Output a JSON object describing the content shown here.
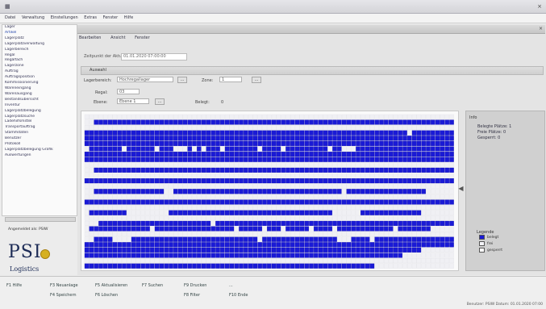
{
  "window": {
    "icon": "app-icon",
    "close_glyph": "×"
  },
  "menubar": [
    {
      "label": "Datei"
    },
    {
      "label": "Verwaltung"
    },
    {
      "label": "Einstellungen"
    },
    {
      "label": "Extras"
    },
    {
      "label": "Fenster"
    },
    {
      "label": "Hilfe"
    }
  ],
  "sidebar": {
    "items": [
      {
        "label": "Lager",
        "selected": false
      },
      {
        "label": "Artikel",
        "selected": true
      },
      {
        "label": "Lagerplatz",
        "selected": false
      },
      {
        "label": "Lagerplatzverwaltung",
        "selected": false
      },
      {
        "label": "Lagerbereich",
        "selected": false
      },
      {
        "label": "Regal",
        "selected": false
      },
      {
        "label": "Regalfach",
        "selected": false
      },
      {
        "label": "Lagerzone",
        "selected": false
      },
      {
        "label": "Auftrag",
        "selected": false
      },
      {
        "label": "Auftragsposition",
        "selected": false
      },
      {
        "label": "Kommissionierung",
        "selected": false
      },
      {
        "label": "Wareneingang",
        "selected": false
      },
      {
        "label": "Warenausgang",
        "selected": false
      },
      {
        "label": "Bestandsübersicht",
        "selected": false
      },
      {
        "label": "Inventur",
        "selected": false
      },
      {
        "label": "Lagerplatzbelegung",
        "selected": false
      },
      {
        "label": "Lagerplatzsuche",
        "selected": false
      },
      {
        "label": "Ladehilfsmittel",
        "selected": false
      },
      {
        "label": "Transportauftrag",
        "selected": false
      },
      {
        "label": "Stammdaten",
        "selected": false
      },
      {
        "label": "Benutzer",
        "selected": false
      },
      {
        "label": "Protokoll",
        "selected": false
      },
      {
        "label": "Lagerplatzbelegung Grafik",
        "selected": false
      },
      {
        "label": "Auswertungen",
        "selected": false
      }
    ],
    "login_text": "Angemeldet als: PSIW"
  },
  "logo": {
    "main": "PSI",
    "sub": "Logistics"
  },
  "child_window": {
    "close_glyph": "×",
    "menu": [
      {
        "label": "Bearbeiten"
      },
      {
        "label": "Ansicht"
      },
      {
        "label": "Fenster"
      }
    ],
    "zeit_label": "Zeitpunkt der Aktualisierung:",
    "zeit_value": "01.01.2020 07:00:00",
    "section_title": "Auswahl",
    "filters": {
      "row1": [
        {
          "label": "Lagerbereich:",
          "value": "Hochregallager",
          "button": "..."
        },
        {
          "label": "Zone:",
          "value": "1",
          "button": "..."
        }
      ],
      "row2": {
        "label": "Regal:",
        "value": "03"
      },
      "row3": [
        {
          "label": "Ebene:",
          "value": "Ebene 1",
          "button": "..."
        },
        {
          "label": "Belegt:",
          "value": "0"
        }
      ]
    },
    "info": {
      "head": "Info",
      "lines": [
        "Belegte Plätze: 1",
        "Freie Plätze: 0",
        "Gesperrt: 0"
      ],
      "legend_title": "Legende",
      "legend": [
        {
          "label": "belegt",
          "color": "#1a1ad6"
        },
        {
          "label": "frei",
          "color": "#f4f4f8"
        },
        {
          "label": "gesperrt",
          "color": "#ffffff"
        }
      ]
    }
  },
  "grid": {
    "filled_color": "#1a1ad6",
    "empty_color": "#f0f0f4",
    "rows": [
      "0000000000000000000000000000000000000000000000000000000000000000000000000000000",
      "0011111111111111111111111111111111111111111111111111111111111111111111111111111",
      "0000000000000000000000000000000000000000000000000000000000000000000000000000000",
      "1111111111111111111111111111111111111111111111111111111111111111111110111111111",
      "1111111111111111111111111111111111111111111111111111111111111111111111111111111",
      "1111111111111111111111111111111111111111111111111111111111111111111111111111111",
      "0111111101111110111000101011101111111011110111111111011000111111111111111111111",
      "1111111111111111111111111111111111111111111111111111111111111111111111111111111",
      "1111111111111111111111111111111111111111111111111111111111111111111111111111111",
      "0000000000000000000000000000000000000000000000000000000000000000000000000000000",
      "0011111111111111111111111111111111111111111111111111111111111111111111111111111",
      "0000000000000000000000000000000000000000000000000000000000000000000000000000000",
      "1111111111111111111111111111111111111111111111111111111111111111111111111111111",
      "0000000000000000000000000000000000000000000000000000000000000000000000000000000",
      "0011111111111111100111111111111111111111111111111111111011111111111111111000000",
      "0000000000000000000000000000000000000000000000000000000000000000000000000000000",
      "1111111111111111111111111111111111111111111111111111111111111111111111111111111",
      "0000000000000000000000000000000000000000000000000000000000000000000000000000000",
      "0111111110000000001111111111111111111111111111111111100000011111111111110000000",
      "0000000000000000000000000000000000000000000000000000000000000000000000000000000",
      "0001111111111111111111111110111111111111111111111111111111111111111111111111111",
      "0111111111111101111111111111111101111101110111110111101111111111110111111100000",
      "0000000000000000000000000000000000000000000000000000000000000000000000000000000",
      "0011110000111111111111111111111111111011111111111111110001111011111111111111111",
      "1111111111111111111111111111111111111111111111111111111111111111111111111111111",
      "1111111111111111111111111111111111111111111111111111111111111111111111110000000",
      "1111111111111111111111111111111111111111111111111111111111111111111100000000000",
      "0000000000000000000000000000000000000000000000000000000000000000000000000000000",
      "1111111111111111111111111111111111111111111111111111111111111100000000000000000"
    ]
  },
  "statusbar": {
    "keys_row1": [
      {
        "label": "F1 Hilfe"
      },
      {
        "label": "F3 Neuanlage"
      },
      {
        "label": "F5 Aktualisieren"
      },
      {
        "label": "F7 Suchen"
      },
      {
        "label": "F9 Drucken"
      },
      {
        "label": "..."
      }
    ],
    "keys_row2": [
      {
        "label": "F4 Speichern"
      },
      {
        "label": "F6 Löschen"
      },
      {
        "label": "F8 Filter"
      },
      {
        "label": "F10 Ende"
      }
    ],
    "right_text": "Benutzer: PSIW   Datum: 01.01.2020 07:00"
  }
}
